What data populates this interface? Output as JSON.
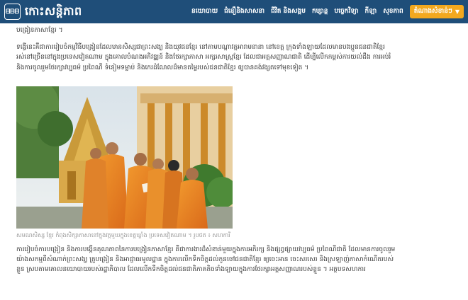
{
  "header": {
    "logo_mark": "ᗺᗹᗷ",
    "site_name": "កោះសន្តិភាព",
    "nav": [
      "នយោបាយ",
      "ជំនឿនិងសាសនា",
      "ជីវិត និងសង្គម",
      "កម្សាន្ត",
      "បច្ចេកវិទ្យា",
      "កីឡា",
      "សុខភាព"
    ],
    "special": "តំណាងសំខាន់ៗ"
  },
  "article": {
    "para0": "បង្រៀនភាសាខ្មែរ ។",
    "para1": "ទង្វើនេះគឺជាការរៀបចំកម្មវិធីបង្រៀនដែលមានសិស្សជាព្រះសង្ឃ និងយុវជនខ្មែរ នៅតាមបណ្តាវត្តអារាមនានា នៅខេត្ត ក្រុងទាំងឡាយដែលមានបងប្អូនជនជាតិខ្មែររស់នៅច្រើននៅក្នុងប្រទេសវៀតណាម ក្នុងគោលបំណងអភិវឌ្ឍន៍ និងថែរក្សាភាសា អក្សរសាស្ត្រខ្មែរ ដែលជាអត្តសញ្ញាណជាតិ ដើម្បីលើកកម្ពស់ការយល់ដឹង ការអប់រំ និងការចូលរួមថែរក្សាវប្បធម៌ ប្រពៃណី ទំនៀមទម្លាប់ និងកេរដំណែលដ៏មានតម្លៃរបស់ជនជាតិខ្មែរ ឲ្យបានគង់វង្សតទៅមុខទៀត ។",
    "caption": "សមណសិស្ស ខ្មែរ កំពុងសិក្សាភាសានៅក្នុងវត្តមួយក្នុងខេត្តឃ្លាំង ប្រទេសវៀតណាម ។ រូបថត ៖ សហការី",
    "para2": "ការរៀបចំការបង្រៀន និងការបង្កើនគុណភាពនៃការបង្រៀនភាសាខ្មែរ គឺជាការងារដ៏សំខាន់មួយក្នុងការអភិរក្ស និងផ្សព្វផ្សាយវប្បធម៌ ប្រពៃណីជាតិ ដែលមានការចូលរួមយ៉ាងសកម្មពីសំណាក់ព្រះសង្ឃ គ្រូបង្រៀន និងអាជ្ញាធរមូលដ្ឋាន ក្នុងការលើកទឹកចិត្តដល់កូនចៅជនជាតិខ្មែរ ឲ្យចេះអាន ចេះសរសេរ និងស្រឡាញ់ភាសាកំណើតរបស់ខ្លួន ស្របតាមគោលនយោបាយរបស់រដ្ឋាភិបាល ដែលលើកទឹកចិត្តដល់ជនជាតិភាគតិចទាំងឡាយក្នុងការថែរក្សាអត្តសញ្ញាណរបស់ខ្លួន ។ អត្ថបទសហការ"
  },
  "colors": {
    "header_bg": "#1f4e79",
    "accent": "#f3a81e"
  }
}
